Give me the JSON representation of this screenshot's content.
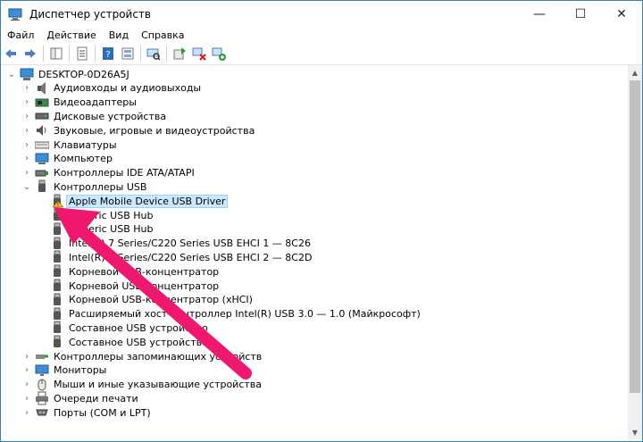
{
  "window": {
    "title": "Диспетчер устройств",
    "controls": {
      "minimize": "—",
      "maximize": "☐",
      "close": "✕"
    }
  },
  "menu": [
    "Файл",
    "Действие",
    "Вид",
    "Справка"
  ],
  "toolbar": [
    "back-icon",
    "forward-icon",
    "sep",
    "show-hide-tree-icon",
    "sep",
    "properties-icon",
    "sep",
    "help-icon",
    "view-icon",
    "sep",
    "scan-hardware-icon",
    "sep",
    "update-driver-icon",
    "disable-device-icon",
    "add-device-icon"
  ],
  "tree": {
    "root": "DESKTOP-0D26A5J",
    "items": [
      {
        "label": "Аудиовходы и аудиовыходы",
        "icon": "audio-icon",
        "expander": ">"
      },
      {
        "label": "Видеоадаптеры",
        "icon": "display-adapter-icon",
        "expander": ">"
      },
      {
        "label": "Дисковые устройства",
        "icon": "disk-drive-icon",
        "expander": ">"
      },
      {
        "label": "Звуковые, игровые и видеоустройства",
        "icon": "sound-icon",
        "expander": ">"
      },
      {
        "label": "Клавиатуры",
        "icon": "keyboard-icon",
        "expander": ">"
      },
      {
        "label": "Компьютер",
        "icon": "computer-icon",
        "expander": ">"
      },
      {
        "label": "Контроллеры IDE ATA/ATAPI",
        "icon": "ide-controller-icon",
        "expander": ">"
      },
      {
        "label": "Контроллеры USB",
        "icon": "usb-plug-icon",
        "expander": "v",
        "children": [
          {
            "label": "Apple Mobile Device USB Driver",
            "icon": "usb-warning-icon",
            "selected": true
          },
          {
            "label": "Generic USB Hub",
            "icon": "usb-plug-icon"
          },
          {
            "label": "Generic USB Hub",
            "icon": "usb-plug-icon"
          },
          {
            "label": "Intel(R) 7 Series/C220 Series USB EHCI 1 — 8C26",
            "icon": "usb-plug-icon"
          },
          {
            "label": "Intel(R) 7 Series/C220 Series USB EHCI 2 — 8C2D",
            "icon": "usb-plug-icon"
          },
          {
            "label": "Корневой USB-концентратор",
            "icon": "usb-plug-icon"
          },
          {
            "label": "Корневой USB-концентратор",
            "icon": "usb-plug-icon"
          },
          {
            "label": "Корневой USB-концентратор (xHCI)",
            "icon": "usb-plug-icon"
          },
          {
            "label": "Расширяемый хост-контроллер Intel(R) USB 3.0 — 1.0 (Майкрософт)",
            "icon": "usb-plug-icon"
          },
          {
            "label": "Составное USB устройство",
            "icon": "usb-plug-icon"
          },
          {
            "label": "Составное USB устройство",
            "icon": "usb-plug-icon"
          }
        ]
      },
      {
        "label": "Контроллеры запоминающих устройств",
        "icon": "storage-controller-icon",
        "expander": ">"
      },
      {
        "label": "Мониторы",
        "icon": "monitor-icon",
        "expander": ">"
      },
      {
        "label": "Мыши и иные указывающие устройства",
        "icon": "mouse-icon",
        "expander": ">"
      },
      {
        "label": "Очереди печати",
        "icon": "printer-icon",
        "expander": ">"
      },
      {
        "label": "Порты (COM и LPT)",
        "icon": "port-icon",
        "expander": ">"
      }
    ]
  },
  "annotation": {
    "arrow_color": "#f0176e"
  }
}
